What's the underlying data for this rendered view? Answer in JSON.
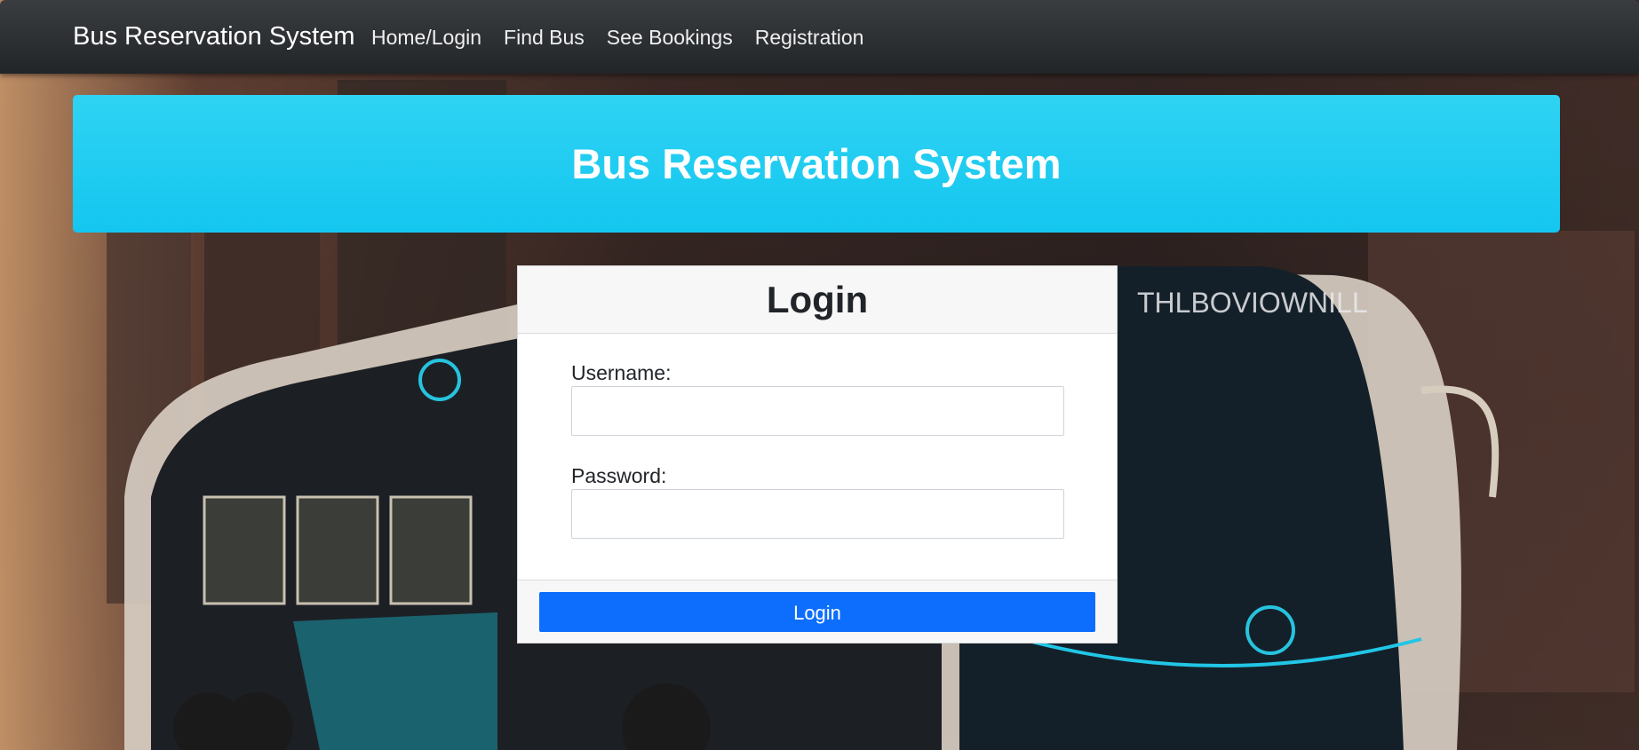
{
  "navbar": {
    "brand": "Bus Reservation System",
    "links": [
      {
        "label": "Home/Login"
      },
      {
        "label": "Find Bus"
      },
      {
        "label": "See Bookings"
      },
      {
        "label": "Registration"
      }
    ]
  },
  "banner": {
    "title": "Bus Reservation System"
  },
  "login_card": {
    "title": "Login",
    "username_label": "Username:",
    "username_value": "",
    "password_label": "Password:",
    "password_value": "",
    "submit_label": "Login"
  },
  "background": {
    "bus_logo_text": "THLBOVIOWNILL"
  },
  "colors": {
    "navbar": "#2b2e31",
    "banner": "#22cdf1",
    "primary_button": "#0d6efd",
    "card_header": "#f7f7f7"
  }
}
